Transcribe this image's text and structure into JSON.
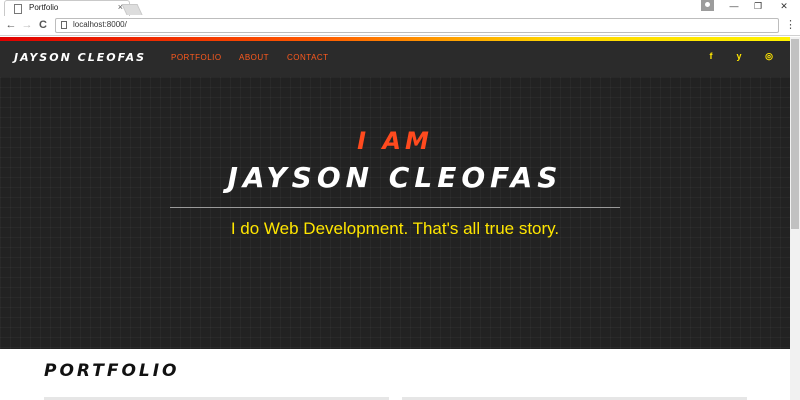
{
  "browser": {
    "tab_title": "Portfolio",
    "tab_close": "×",
    "url": "localhost:8000/",
    "back": "←",
    "forward": "→",
    "reload": "C",
    "menu": "⋮",
    "minimize": "—",
    "restore": "❐",
    "close": "✕"
  },
  "navbar": {
    "brand": "JAYSON CLEOFAS",
    "links": [
      "PORTFOLIO",
      "ABOUT",
      "CONTACT"
    ],
    "social": [
      {
        "icon": "facebook-icon",
        "glyph": "f"
      },
      {
        "icon": "twitter-icon",
        "glyph": "y"
      },
      {
        "icon": "instagram-icon",
        "glyph": "◎"
      }
    ],
    "accent": "#ff5a1e",
    "social_color": "#ffe600"
  },
  "hero": {
    "kicker": "I AM",
    "name": "JAYSON CLEOFAS",
    "tagline": "I do Web Development. That's all true story."
  },
  "portfolio": {
    "heading": "PORTFOLIO"
  }
}
